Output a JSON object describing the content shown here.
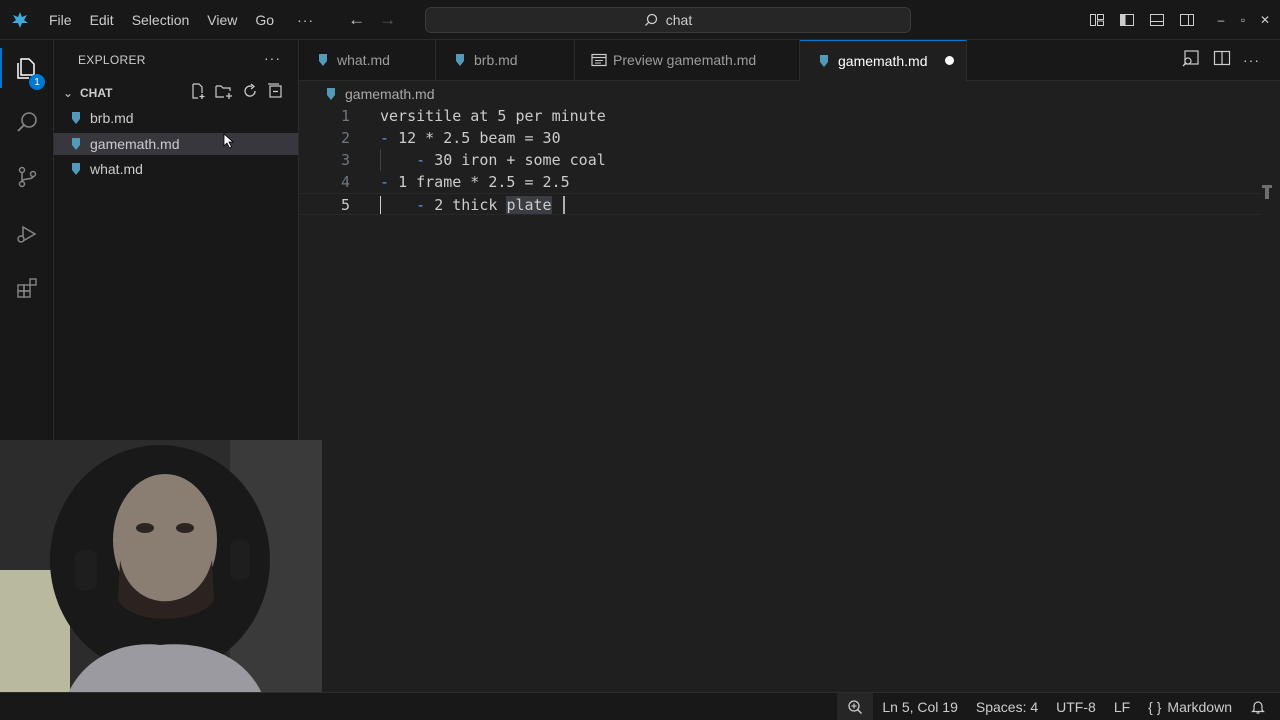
{
  "menu": {
    "items": [
      "File",
      "Edit",
      "Selection",
      "View",
      "Go"
    ],
    "more": "···"
  },
  "command_center": {
    "text": "chat"
  },
  "activity_bar": {
    "explorer_badge": "1"
  },
  "sidebar": {
    "title": "EXPLORER",
    "more": "···",
    "section": "CHAT",
    "files": [
      "brb.md",
      "gamemath.md",
      "what.md"
    ]
  },
  "tabs": [
    {
      "label": "what.md"
    },
    {
      "label": "brb.md"
    },
    {
      "label": "Preview gamemath.md"
    },
    {
      "label": "gamemath.md"
    }
  ],
  "breadcrumb": {
    "file": "gamemath.md"
  },
  "editor": {
    "lines": [
      {
        "number": "1",
        "text": "versitile at 5 per minute"
      },
      {
        "number": "2",
        "dash": "- ",
        "text": "12 * 2.5 beam = 30"
      },
      {
        "number": "3",
        "indent": "    ",
        "dash": "- ",
        "text": "30 iron + some coal"
      },
      {
        "number": "4",
        "dash": "- ",
        "text": "1 frame * 2.5 = 2.5"
      },
      {
        "number": "5",
        "indent": "    ",
        "dash": "- ",
        "text": "2 thick ",
        "selected": "plate"
      }
    ]
  },
  "status": {
    "position": "Ln 5, Col 19",
    "spaces": "Spaces: 4",
    "encoding": "UTF-8",
    "eol": "LF",
    "language_braces": "{ }",
    "language": "Markdown"
  },
  "colors": {
    "accent": "#0078d4",
    "markdown_icon": "#519aba"
  }
}
